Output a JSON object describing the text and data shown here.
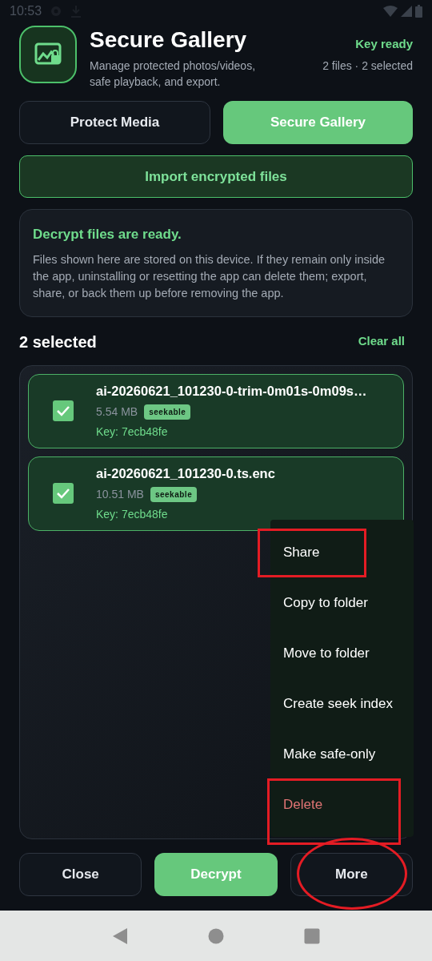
{
  "status_bar": {
    "time": "10:53"
  },
  "header": {
    "title": "Secure Gallery",
    "subtitle": "Manage protected photos/videos, safe playback, and export.",
    "key_status": "Key ready",
    "counts": "2 files · 2 selected"
  },
  "tabs": [
    {
      "label": "Protect Media",
      "selected": false
    },
    {
      "label": "Secure Gallery",
      "selected": true
    }
  ],
  "import_button": "Import encrypted files",
  "notice": {
    "title": "Decrypt files are ready.",
    "body": "Files shown here are stored on this device. If they remain only inside the app, uninstalling or resetting the app can delete them; export, share, or back them up before removing the app."
  },
  "selection": {
    "label": "2 selected",
    "clear": "Clear all"
  },
  "files": [
    {
      "name": "ai-20260621_101230-0-trim-0m01s-0m09s…",
      "size": "5.54 MB",
      "tag": "seekable",
      "key": "Key: 7ecb48fe",
      "checked": true
    },
    {
      "name": "ai-20260621_101230-0.ts.enc",
      "size": "10.51 MB",
      "tag": "seekable",
      "key": "Key: 7ecb48fe",
      "checked": true
    }
  ],
  "menu": [
    {
      "label": "Share",
      "kind": "normal",
      "highlighted": true
    },
    {
      "label": "Copy to folder",
      "kind": "normal",
      "highlighted": false
    },
    {
      "label": "Move to folder",
      "kind": "normal",
      "highlighted": false
    },
    {
      "label": "Create seek index",
      "kind": "normal",
      "highlighted": false
    },
    {
      "label": "Make safe-only",
      "kind": "normal",
      "highlighted": false
    },
    {
      "label": "Delete",
      "kind": "danger",
      "highlighted": true
    }
  ],
  "buttons": [
    {
      "label": "Close",
      "kind": "outline",
      "circled": false
    },
    {
      "label": "Decrypt",
      "kind": "primary",
      "circled": false
    },
    {
      "label": "More",
      "kind": "outline",
      "circled": true
    }
  ]
}
